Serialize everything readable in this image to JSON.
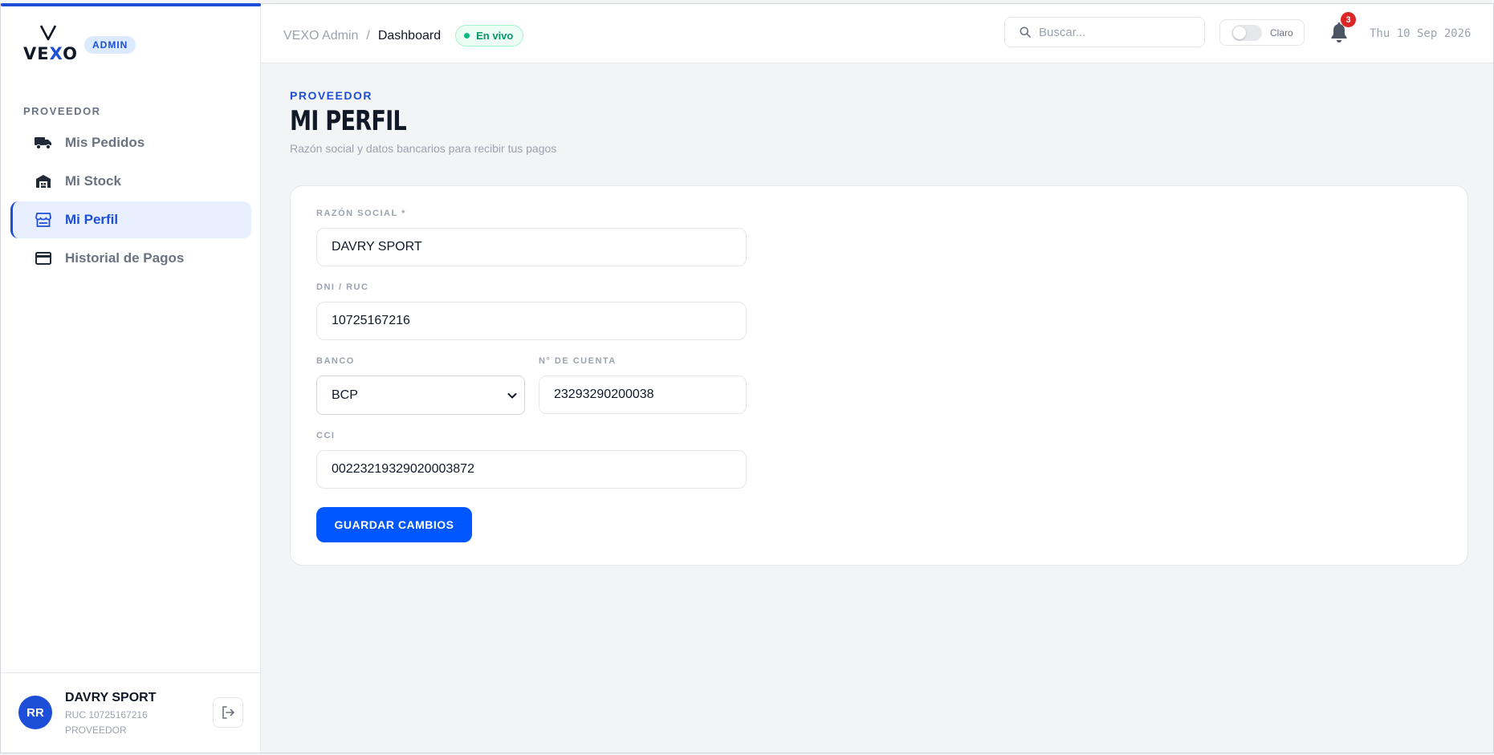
{
  "brand": {
    "logo_text": "VEXO",
    "badge": "ADMIN"
  },
  "sidebar": {
    "section_label": "PROVEEDOR",
    "items": [
      {
        "label": "Mis Pedidos",
        "icon": "truck-icon",
        "active": false
      },
      {
        "label": "Mi Stock",
        "icon": "warehouse-icon",
        "active": false
      },
      {
        "label": "Mi Perfil",
        "icon": "storefront-icon",
        "active": true
      },
      {
        "label": "Historial de Pagos",
        "icon": "credit-card-icon",
        "active": false
      }
    ],
    "user": {
      "initials": "RR",
      "name": "DAVRY SPORT",
      "ruc": "RUC 10725167216",
      "role": "PROVEEDOR"
    }
  },
  "topbar": {
    "breadcrumb_root": "VEXO Admin",
    "breadcrumb_separator": "/",
    "breadcrumb_current": "Dashboard",
    "live_label": "En vivo",
    "search_placeholder": "Buscar...",
    "theme_label": "Claro",
    "notification_count": "3",
    "date": "Thu 10 Sep 2026"
  },
  "page": {
    "section": "PROVEEDOR",
    "title": "MI PERFIL",
    "subtitle": "Razón social y datos bancarios para recibir tus pagos"
  },
  "form": {
    "razon_social": {
      "label": "RAZÓN SOCIAL *",
      "value": "DAVRY SPORT"
    },
    "dni_ruc": {
      "label": "DNI / RUC",
      "value": "10725167216"
    },
    "banco": {
      "label": "BANCO",
      "value": "BCP"
    },
    "cuenta": {
      "label": "N° DE CUENTA",
      "value": "23293290200038"
    },
    "cci": {
      "label": "CCI",
      "value": "00223219329020003872"
    },
    "save_label": "GUARDAR CAMBIOS"
  },
  "colors": {
    "accent": "#1d4ed8",
    "button": "#0057ff",
    "live": "#10b981",
    "notification": "#dc2626"
  }
}
